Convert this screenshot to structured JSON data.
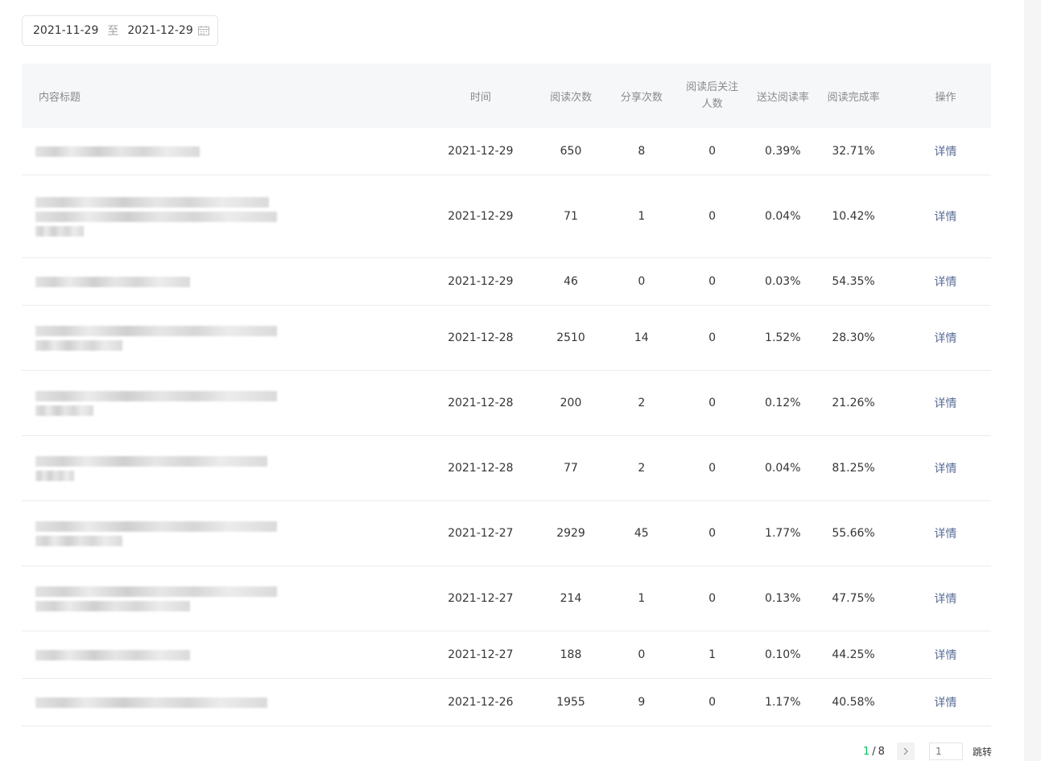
{
  "date_range": {
    "start": "2021-11-29",
    "separator": "至",
    "end": "2021-12-29"
  },
  "table": {
    "headers": {
      "title": "内容标题",
      "time": "时间",
      "reads": "阅读次数",
      "shares": "分享次数",
      "follows_line1": "阅读后关注",
      "follows_line2": "人数",
      "delivery_rate": "送达阅读率",
      "completion_rate": "阅读完成率",
      "action": "操作"
    },
    "detail_label": "详情",
    "rows": [
      {
        "time": "2021-12-29",
        "reads": "650",
        "shares": "8",
        "follows": "0",
        "delivery_rate": "0.39%",
        "completion_rate": "32.71%"
      },
      {
        "time": "2021-12-29",
        "reads": "71",
        "shares": "1",
        "follows": "0",
        "delivery_rate": "0.04%",
        "completion_rate": "10.42%"
      },
      {
        "time": "2021-12-29",
        "reads": "46",
        "shares": "0",
        "follows": "0",
        "delivery_rate": "0.03%",
        "completion_rate": "54.35%"
      },
      {
        "time": "2021-12-28",
        "reads": "2510",
        "shares": "14",
        "follows": "0",
        "delivery_rate": "1.52%",
        "completion_rate": "28.30%"
      },
      {
        "time": "2021-12-28",
        "reads": "200",
        "shares": "2",
        "follows": "0",
        "delivery_rate": "0.12%",
        "completion_rate": "21.26%"
      },
      {
        "time": "2021-12-28",
        "reads": "77",
        "shares": "2",
        "follows": "0",
        "delivery_rate": "0.04%",
        "completion_rate": "81.25%"
      },
      {
        "time": "2021-12-27",
        "reads": "2929",
        "shares": "45",
        "follows": "0",
        "delivery_rate": "1.77%",
        "completion_rate": "55.66%"
      },
      {
        "time": "2021-12-27",
        "reads": "214",
        "shares": "1",
        "follows": "0",
        "delivery_rate": "0.13%",
        "completion_rate": "47.75%"
      },
      {
        "time": "2021-12-27",
        "reads": "188",
        "shares": "0",
        "follows": "1",
        "delivery_rate": "0.10%",
        "completion_rate": "44.25%"
      },
      {
        "time": "2021-12-26",
        "reads": "1955",
        "shares": "9",
        "follows": "0",
        "delivery_rate": "1.17%",
        "completion_rate": "40.58%"
      }
    ]
  },
  "pagination": {
    "current": "1",
    "separator": "/",
    "total": "8",
    "jump_placeholder": "1",
    "jump_label": "跳转"
  },
  "icons": {
    "date_picker": "calendar-icon",
    "next_page": "chevron-right-icon"
  }
}
